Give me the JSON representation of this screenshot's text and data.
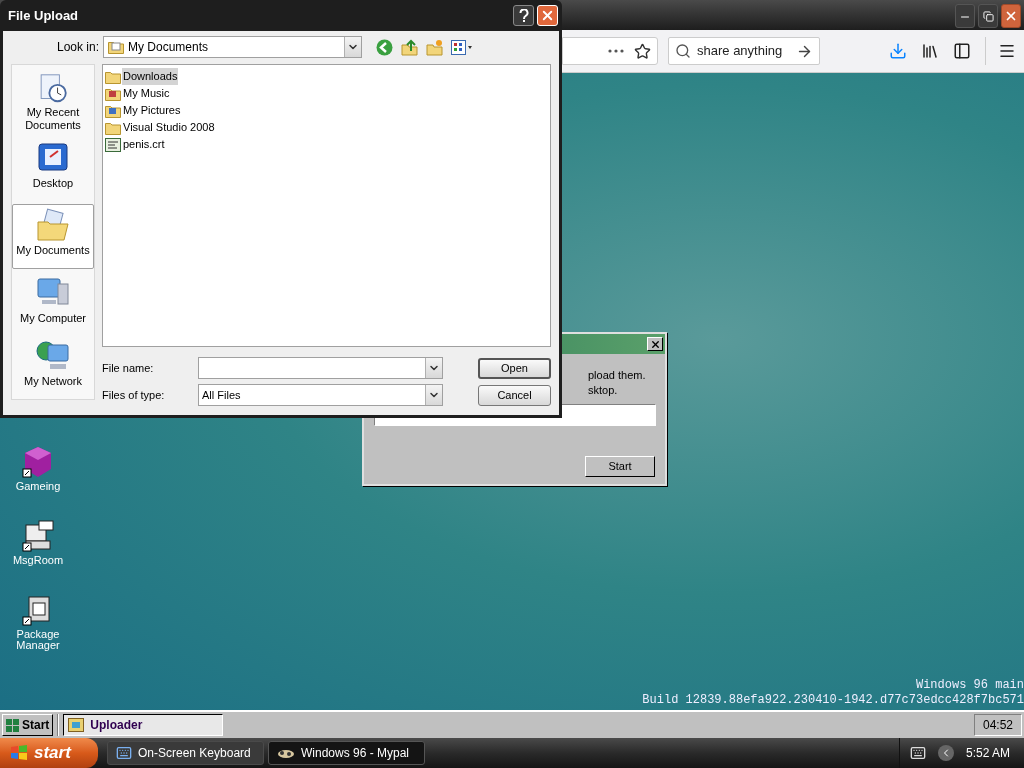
{
  "browser": {
    "search": {
      "value": "share anything"
    }
  },
  "desktop_icons": [
    {
      "label": "Gameing",
      "kind": "cube"
    },
    {
      "label": "MsgRoom",
      "kind": "computer"
    },
    {
      "label": "Package Manager",
      "kind": "package"
    }
  ],
  "uploader": {
    "text_lines": [
      "pload them.",
      "sktop."
    ],
    "start_button": "Start"
  },
  "build_info": [
    "Windows 96 main",
    "Build 12839.88efa922.230410-1942.d77c73edcc428f7bc571"
  ],
  "w96_taskbar": {
    "start": "Start",
    "tasks": [
      {
        "label": "Uploader",
        "selected": true
      }
    ],
    "clock": "04:52"
  },
  "file_dialog": {
    "title": "File Upload",
    "look_in_label": "Look in:",
    "look_in_value": "My Documents",
    "places": [
      {
        "label": "My Recent Documents",
        "kind": "recent",
        "selected": false
      },
      {
        "label": "Desktop",
        "kind": "desktop",
        "selected": false
      },
      {
        "label": "My Documents",
        "kind": "documents",
        "selected": true
      },
      {
        "label": "My Computer",
        "kind": "computer",
        "selected": false
      },
      {
        "label": "My Network",
        "kind": "network",
        "selected": false
      }
    ],
    "files": [
      {
        "name": "Downloads",
        "kind": "folder",
        "selected": true
      },
      {
        "name": "My Music",
        "kind": "music",
        "selected": false
      },
      {
        "name": "My Pictures",
        "kind": "pictures",
        "selected": false
      },
      {
        "name": "Visual Studio 2008",
        "kind": "folder",
        "selected": false
      },
      {
        "name": "penis.crt",
        "kind": "certificate",
        "selected": false
      }
    ],
    "file_name_label": "File name:",
    "files_of_type_label": "Files of type:",
    "files_of_type_value": "All Files",
    "buttons": [
      "Open",
      "Cancel"
    ]
  },
  "xp_taskbar": {
    "start": "start",
    "tasks": [
      {
        "label": "On-Screen Keyboard",
        "kind": "keyboard",
        "selected": false
      },
      {
        "label": "Windows 96 - Mypal",
        "kind": "browser",
        "selected": true
      }
    ],
    "clock": "5:52 AM"
  }
}
